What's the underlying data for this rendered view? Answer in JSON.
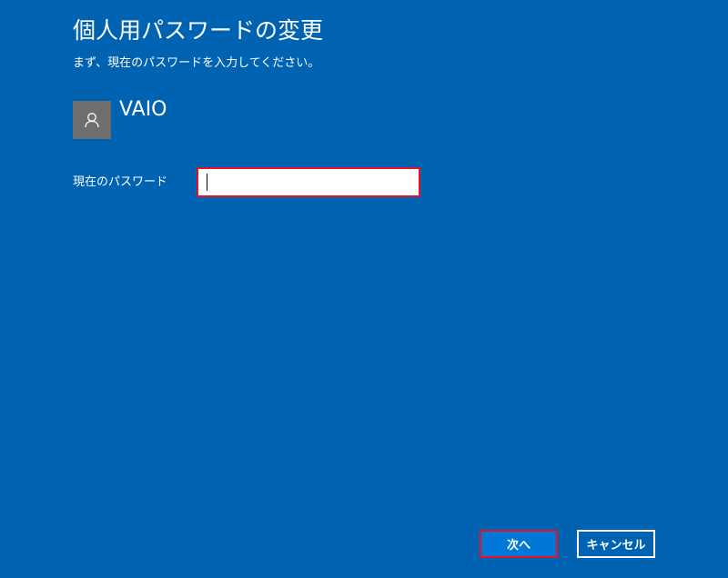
{
  "dialog": {
    "title": "個人用パスワードの変更",
    "subtitle": "まず、現在のパスワードを入力してください。"
  },
  "account": {
    "username": "VAIO",
    "avatar_icon": "user-icon"
  },
  "form": {
    "current_password_label": "現在のパスワード",
    "current_password_value": ""
  },
  "buttons": {
    "next_label": "次へ",
    "cancel_label": "キャンセル"
  },
  "colors": {
    "background": "#0063b1",
    "highlight": "#e81123",
    "primary_button": "#0078d7"
  }
}
